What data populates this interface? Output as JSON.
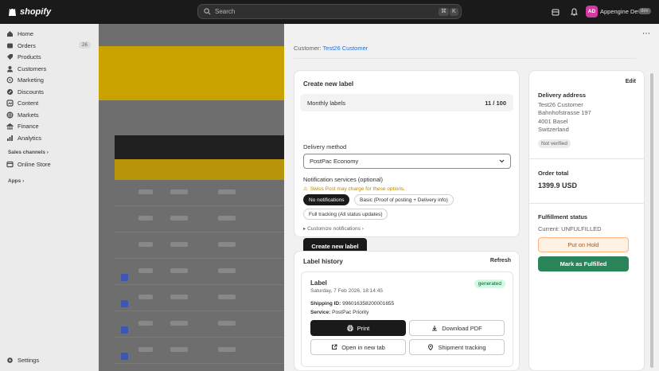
{
  "topbar": {
    "brand": "shopify",
    "search_placeholder": "Search",
    "shortcut_keys": [
      "⌘",
      "K"
    ],
    "store_name": "Appengine Dev",
    "store_badge": "dev",
    "avatar_initials": "AD"
  },
  "sidebar": {
    "items": [
      {
        "label": "Home",
        "icon": "home-icon"
      },
      {
        "label": "Orders",
        "icon": "orders-icon",
        "count": "26"
      },
      {
        "label": "Products",
        "icon": "products-icon"
      },
      {
        "label": "Customers",
        "icon": "customers-icon"
      },
      {
        "label": "Marketing",
        "icon": "marketing-icon"
      },
      {
        "label": "Discounts",
        "icon": "discounts-icon"
      },
      {
        "label": "Content",
        "icon": "content-icon"
      },
      {
        "label": "Markets",
        "icon": "markets-icon"
      },
      {
        "label": "Finance",
        "icon": "finance-icon"
      },
      {
        "label": "Analytics",
        "icon": "analytics-icon"
      }
    ],
    "sales_channels_label": "Sales channels",
    "online_store_label": "Online Store",
    "apps_label": "Apps",
    "settings_label": "Settings"
  },
  "modal": {
    "customer_prefix": "Customer:",
    "customer_name": "Test26 Customer",
    "create_label": {
      "title": "Create new label",
      "monthly_label": "Monthly labels",
      "monthly_value": "11 / 100",
      "delivery_method_label": "Delivery method",
      "delivery_method_value": "PostPac Economy",
      "notification_label": "Notification services (optional)",
      "warning": "Swiss Post may charge for these options.",
      "options": [
        "No notifications",
        "Basic (Proof of posting + Delivery info)",
        "Full tracking (All status updates)"
      ],
      "selected_option": "No notifications",
      "customize": "Customize notifications",
      "create_button": "Create new label"
    },
    "label_history": {
      "title": "Label history",
      "refresh": "Refresh",
      "label_title": "Label",
      "label_date": "Saturday, 7 Feb 2026, 18:14:45",
      "status": "generated",
      "shipping_id_label": "Shipping ID:",
      "shipping_id": "996016358200001655",
      "service_label": "Service:",
      "service": "PostPac Priority",
      "print": "Print",
      "download_pdf": "Download PDF",
      "open_new_tab": "Open in new tab",
      "shipment_tracking": "Shipment tracking"
    },
    "side": {
      "edit": "Edit",
      "delivery_address_title": "Delivery address",
      "address_lines": [
        "Test26 Customer",
        "Bahnhofstrasse 197",
        "4001 Basel",
        "Switzerland"
      ],
      "verification": "Not verified",
      "order_total_title": "Order total",
      "order_total": "1399.9 USD",
      "fulfillment_title": "Fulfillment status",
      "fulfillment_current": "Current: UNFULFILLED",
      "put_on_hold": "Put on Hold",
      "mark_fulfilled": "Mark as Fulfilled"
    }
  },
  "colors": {
    "primary": "#1a1a1a",
    "link": "#2c6ecb",
    "success": "#29845a",
    "warning": "#c24f0b"
  }
}
